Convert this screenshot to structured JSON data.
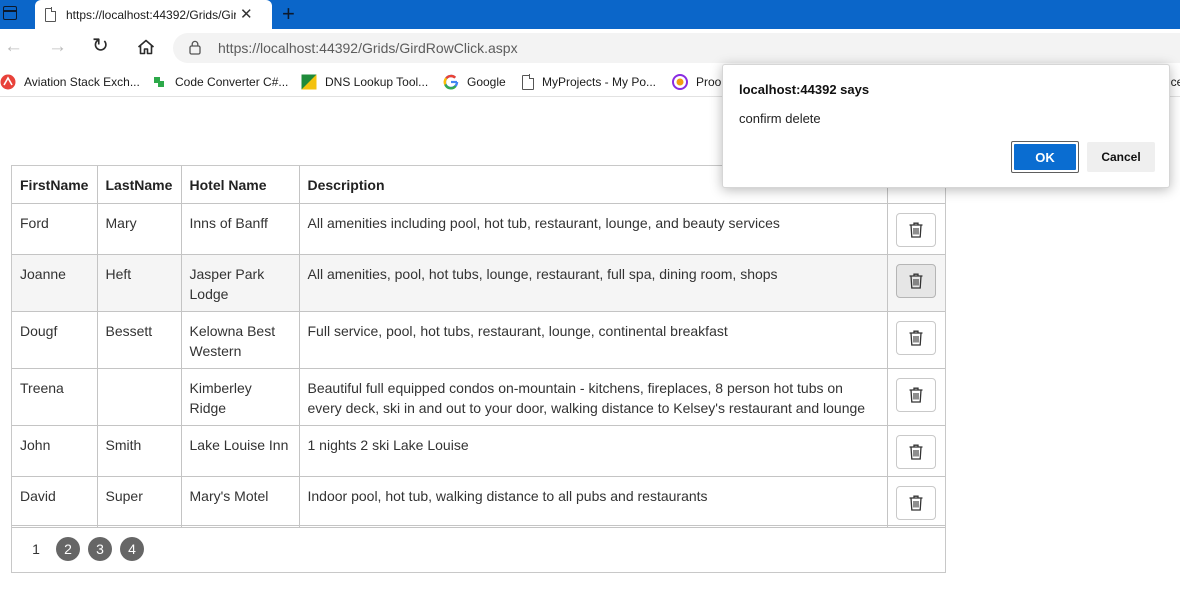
{
  "browser": {
    "tab_title": "https://localhost:44392/Grids/Gir",
    "url": "https://localhost:44392/Grids/GirdRowClick.aspx",
    "bookmarks": [
      {
        "label": "Aviation Stack Exch...",
        "icon": "aviation-icon"
      },
      {
        "label": "Code Converter C#...",
        "icon": "code-converter-icon"
      },
      {
        "label": "DNS Lookup Tool...",
        "icon": "dns-lookup-icon"
      },
      {
        "label": "Google",
        "icon": "google-icon"
      },
      {
        "label": "MyProjects - My Po...",
        "icon": "page-icon"
      },
      {
        "label": "Proo",
        "icon": "proo-icon"
      },
      {
        "label": "ice",
        "icon": ""
      }
    ]
  },
  "dialog": {
    "title": "localhost:44392 says",
    "message": "confirm delete",
    "ok_label": "OK",
    "cancel_label": "Cancel"
  },
  "grid": {
    "headers": [
      "FirstName",
      "LastName",
      "Hotel Name",
      "Description",
      ""
    ],
    "rows": [
      {
        "first": "Ford",
        "last": "Mary",
        "hotel": "Inns of Banff",
        "desc": "All amenities including pool, hot tub, restaurant, lounge, and beauty services"
      },
      {
        "first": "Joanne",
        "last": "Heft",
        "hotel": "Jasper Park Lodge",
        "desc": "All amenities, pool, hot tubs, lounge, restaurant, full spa, dining room, shops"
      },
      {
        "first": "Dougf",
        "last": "Bessett",
        "hotel": "Kelowna Best Western",
        "desc": "Full service, pool, hot tubs, restaurant, lounge, continental breakfast"
      },
      {
        "first": "Treena",
        "last": "",
        "hotel": "Kimberley Ridge",
        "desc": "Beautiful full equipped condos on-mountain - kitchens, fireplaces, 8 person hot tubs on every deck, ski in and out to your door, walking distance to Kelsey's restaurant and lounge"
      },
      {
        "first": "John",
        "last": "Smith",
        "hotel": "Lake Louise Inn",
        "desc": "1 nights 2 ski Lake Louise"
      },
      {
        "first": "David",
        "last": "Super",
        "hotel": "Mary's Motel",
        "desc": "Indoor pool, hot tub, walking distance to all pubs and restaurants"
      }
    ],
    "pager": {
      "current": "1",
      "pages": [
        "2",
        "3",
        "4"
      ]
    }
  },
  "colors": {
    "tabstrip": "#0b66c9",
    "ok_button": "#0a6dd1",
    "pager_bubble": "#666666",
    "alt_row": "#f5f5f5"
  }
}
